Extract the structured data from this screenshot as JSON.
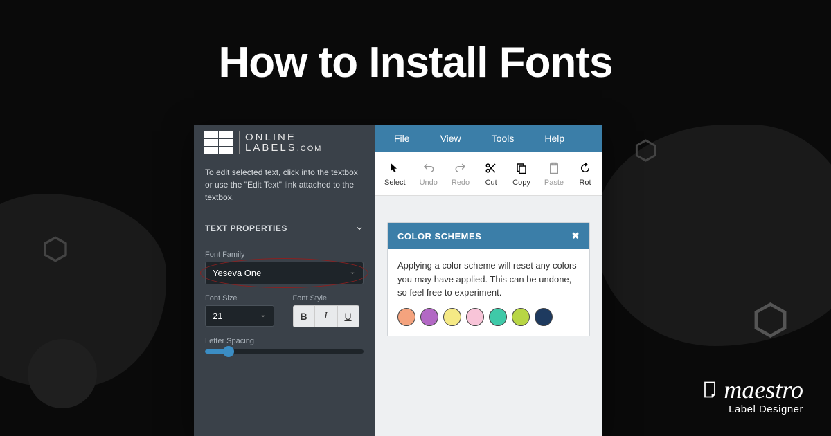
{
  "title": "How to Install Fonts",
  "logo": {
    "line1": "ONLINE",
    "line2": "LABELS",
    "line3": ".COM"
  },
  "sidebar": {
    "hint": "To edit selected text, click into the textbox or use the \"Edit Text\" link attached to the textbox.",
    "section_title": "TEXT PROPERTIES",
    "font_family_label": "Font Family",
    "font_family_value": "Yeseva One",
    "font_size_label": "Font Size",
    "font_size_value": "21",
    "font_style_label": "Font Style",
    "bold": "B",
    "italic": "I",
    "underline": "U",
    "letter_spacing_label": "Letter Spacing"
  },
  "menubar": [
    "File",
    "View",
    "Tools",
    "Help"
  ],
  "toolbar": {
    "select": "Select",
    "undo": "Undo",
    "redo": "Redo",
    "cut": "Cut",
    "copy": "Copy",
    "paste": "Paste",
    "rotate": "Rot"
  },
  "panel": {
    "title": "COLOR SCHEMES",
    "body": "Applying a color scheme will reset any colors you may have applied. This can be undone, so feel free to experiment.",
    "swatches": [
      "#f4a37e",
      "#b268c4",
      "#f5e985",
      "#f8c4d8",
      "#3fc9a8",
      "#b8d645",
      "#1e3a5f"
    ]
  },
  "brand": {
    "main": "maestro",
    "sub": "Label Designer"
  }
}
